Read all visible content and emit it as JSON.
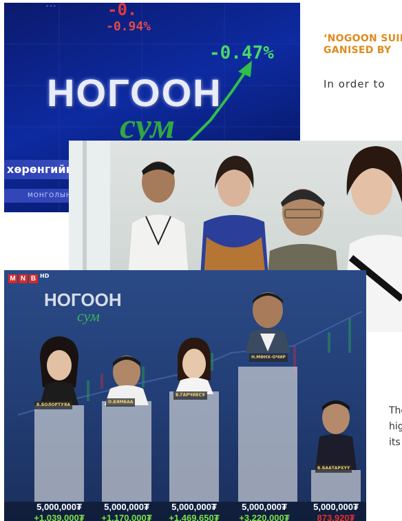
{
  "article": {
    "title_line1": "‘NOGOON SUIKH",
    "title_line2": "GANISED BY",
    "lead": "In order to",
    "cut_line1": "The",
    "cut_line2": "hig",
    "cut_line3": "its"
  },
  "image1": {
    "ticker_top": "...",
    "neg_value_1": "-0.",
    "neg_value_2": "-0.94%",
    "pos_value": "-0.47%",
    "logo_main": "НОГООН",
    "logo_sub": "сум",
    "strip_text": "хөрөнгийн",
    "strip2_text": "МОНГОЛЫН"
  },
  "image3": {
    "channel": [
      "M",
      "N",
      "B"
    ],
    "channel_hd": "HD",
    "logo_main": "НОГООН",
    "logo_sub": "сум",
    "participants": [
      {
        "name": "Б.БОЛОРТУЯА",
        "base": "5,000,000₮",
        "gain": "+1,039,000₮",
        "negative": false
      },
      {
        "name": "О.БЯМБАА",
        "base": "5,000,000₮",
        "gain": "+1,170,000₮",
        "negative": false
      },
      {
        "name": "Б.ГАРЧИЕСЭ",
        "base": "5,000,000₮",
        "gain": "+1,469,650₮",
        "negative": false
      },
      {
        "name": "Н.МӨНХ-ОЧИР",
        "base": "5,000,000₮",
        "gain": "+3,220,000₮",
        "negative": false
      },
      {
        "name": "Б.БААТАРХҮҮ",
        "base": "5,000,000₮",
        "gain": "873,920₮",
        "negative": true
      }
    ],
    "colors": {
      "gain": "#7de04a",
      "loss": "#e03030",
      "title_orange": "#e08a1c"
    }
  }
}
